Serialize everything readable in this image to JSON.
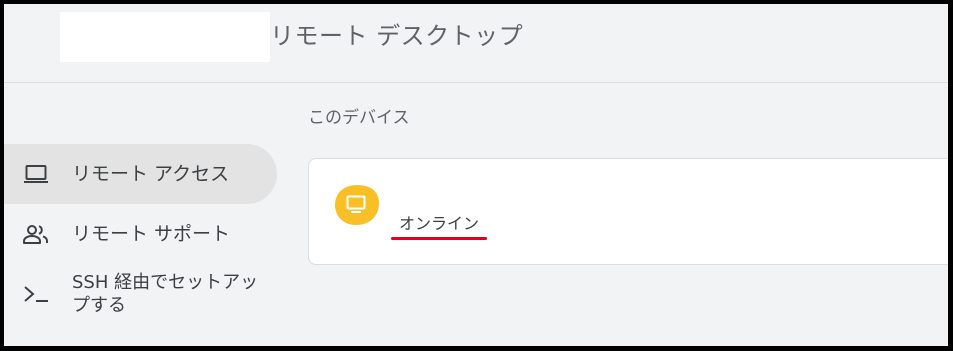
{
  "header": {
    "title": "リモート デスクトップ"
  },
  "nav": {
    "items": [
      {
        "label": "リモート アクセス",
        "icon": "laptop-icon",
        "active": true
      },
      {
        "label": "リモート サポート",
        "icon": "people-icon",
        "active": false
      },
      {
        "label": "SSH 経由でセットアップする",
        "icon": "terminal-icon",
        "active": false
      }
    ]
  },
  "main": {
    "section_title": "このデバイス",
    "device": {
      "status": "オンライン",
      "icon": "monitor-icon"
    }
  },
  "colors": {
    "background": "#f1f3f4",
    "card": "#ffffff",
    "active_nav": "#e3e3e3",
    "device_icon": "#f9bf26",
    "annotation_underline": "#e00021"
  }
}
